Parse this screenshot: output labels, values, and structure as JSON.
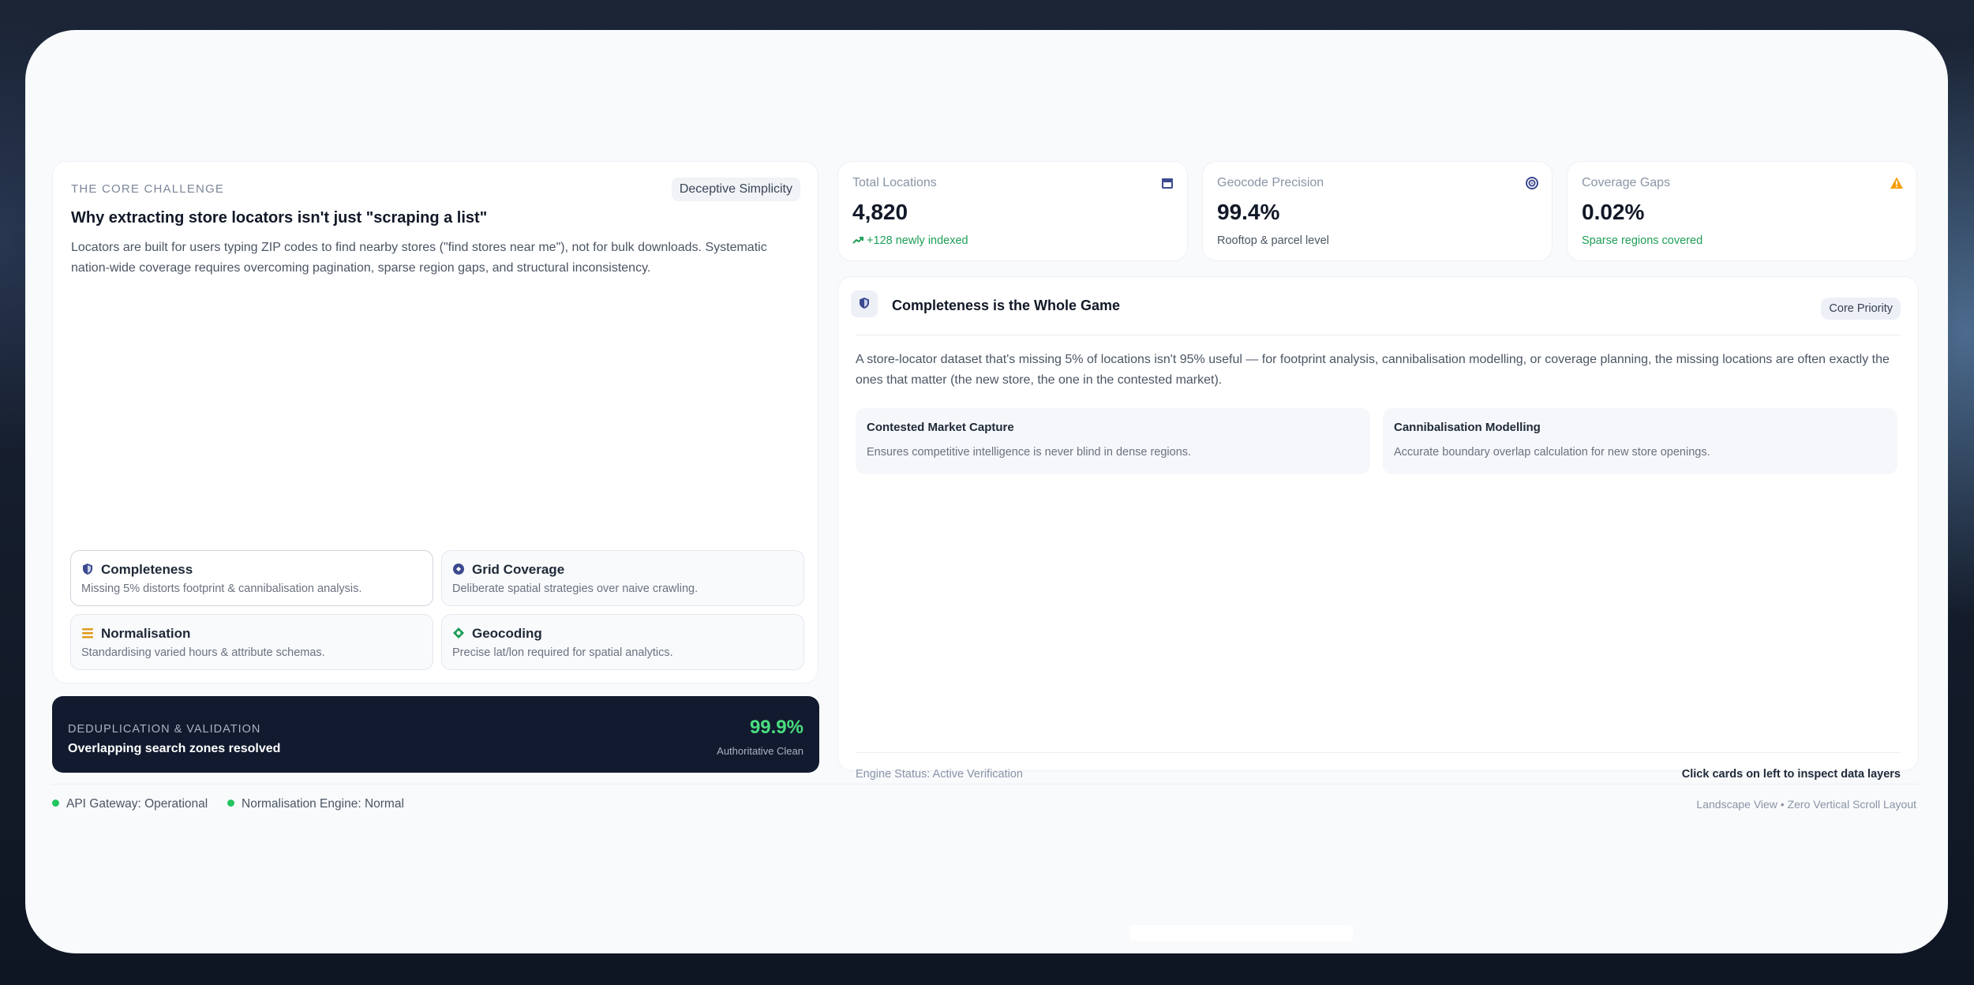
{
  "challenge": {
    "eyebrow": "THE CORE CHALLENGE",
    "tag": "Deceptive Simplicity",
    "title": "Why extracting store locators isn't just \"scraping a list\"",
    "description": "Locators are built for users typing ZIP codes to find nearby stores (\"find stores near me\"), not for bulk downloads. Systematic nation-wide coverage requires overcoming pagination, sparse region gaps, and structural inconsistency.",
    "features": [
      {
        "title": "Completeness",
        "desc": "Missing 5% distorts footprint & cannibalisation analysis.",
        "icon": "shield-icon",
        "active": true
      },
      {
        "title": "Grid Coverage",
        "desc": "Deliberate spatial strategies over naive crawling.",
        "icon": "grid-icon",
        "active": false
      },
      {
        "title": "Normalisation",
        "desc": "Standardising varied hours & attribute schemas.",
        "icon": "list-icon",
        "active": false
      },
      {
        "title": "Geocoding",
        "desc": "Precise lat/lon required for spatial analytics.",
        "icon": "geocode-icon",
        "active": false
      }
    ]
  },
  "dedup": {
    "label": "DEDUPLICATION & VALIDATION",
    "title": "Overlapping search zones resolved",
    "value": "99.9%",
    "sub": "Authoritative Clean"
  },
  "stats": [
    {
      "label": "Total Locations",
      "value": "4,820",
      "sub": "+128 newly indexed",
      "icon": "store-icon"
    },
    {
      "label": "Geocode Precision",
      "value": "99.4%",
      "sub": "Rooftop & parcel level",
      "icon": "target-icon"
    },
    {
      "label": "Coverage Gaps",
      "value": "0.02%",
      "sub": "Sparse regions covered",
      "icon": "warning-icon"
    }
  ],
  "panel": {
    "title": "Completeness is the Whole Game",
    "pill": "Core Priority",
    "description": "A store-locator dataset that's missing 5% of locations isn't 95% useful — for footprint analysis, cannibalisation modelling, or coverage planning, the missing locations are often exactly the ones that matter (the new store, the one in the contested market).",
    "cards": [
      {
        "title": "Contested Market Capture",
        "desc": "Ensures competitive intelligence is never blind in dense regions."
      },
      {
        "title": "Cannibalisation Modelling",
        "desc": "Accurate boundary overlap calculation for new store openings."
      }
    ],
    "engine_status": "Engine Status: Active Verification",
    "hint": "Click cards on left to inspect data layers"
  },
  "footer": {
    "status_1": "API Gateway: Operational",
    "status_2": "Normalisation Engine: Normal",
    "note": "Landscape View • Zero Vertical Scroll Layout"
  },
  "colors": {
    "accent": "#4f5bd5",
    "success": "#22c55e",
    "warning": "#f59e0b",
    "dark": "#111a2e"
  }
}
